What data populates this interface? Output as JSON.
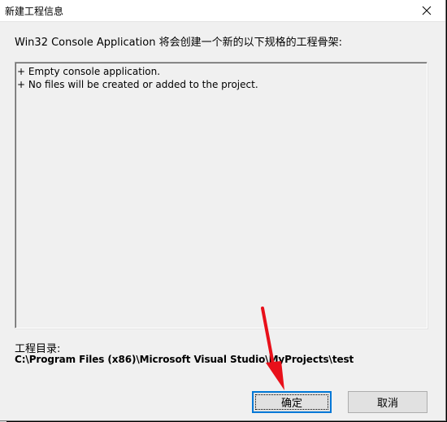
{
  "window": {
    "title": "新建工程信息"
  },
  "intro": "Win32 Console Application 将会创建一个新的以下规格的工程骨架:",
  "description_lines": [
    "+ Empty console application.",
    "+ No files will be created or added to the project."
  ],
  "project_dir": {
    "label": "工程目录:",
    "path": "C:\\Program Files (x86)\\Microsoft Visual Studio\\MyProjects\\test"
  },
  "buttons": {
    "ok": "确定",
    "cancel": "取消"
  },
  "icons": {
    "close": "close-icon",
    "annotation": "arrow-annotation-icon"
  },
  "colors": {
    "annotation": "#e8101a",
    "focus": "#0078d7"
  }
}
